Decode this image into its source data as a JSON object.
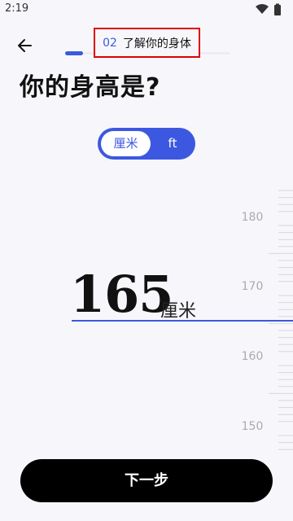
{
  "status_bar": {
    "time": "2:19",
    "icons": [
      "wifi-icon",
      "battery-icon"
    ]
  },
  "header": {
    "step_number": "02",
    "step_title": "了解你的身体"
  },
  "progress": {
    "fraction": 0.11
  },
  "title": "你的身高是?",
  "unit_toggle": {
    "options": [
      "厘米",
      "ft"
    ],
    "selected": "厘米"
  },
  "height": {
    "value": "165",
    "unit": "厘米"
  },
  "ruler": {
    "labels": [
      "180",
      "170",
      "160",
      "150"
    ]
  },
  "next_button": {
    "label": "下一步"
  },
  "colors": {
    "accent": "#3d58e0",
    "highlight_box": "#e00000",
    "button": "#000000",
    "background": "#f7f7fb"
  }
}
